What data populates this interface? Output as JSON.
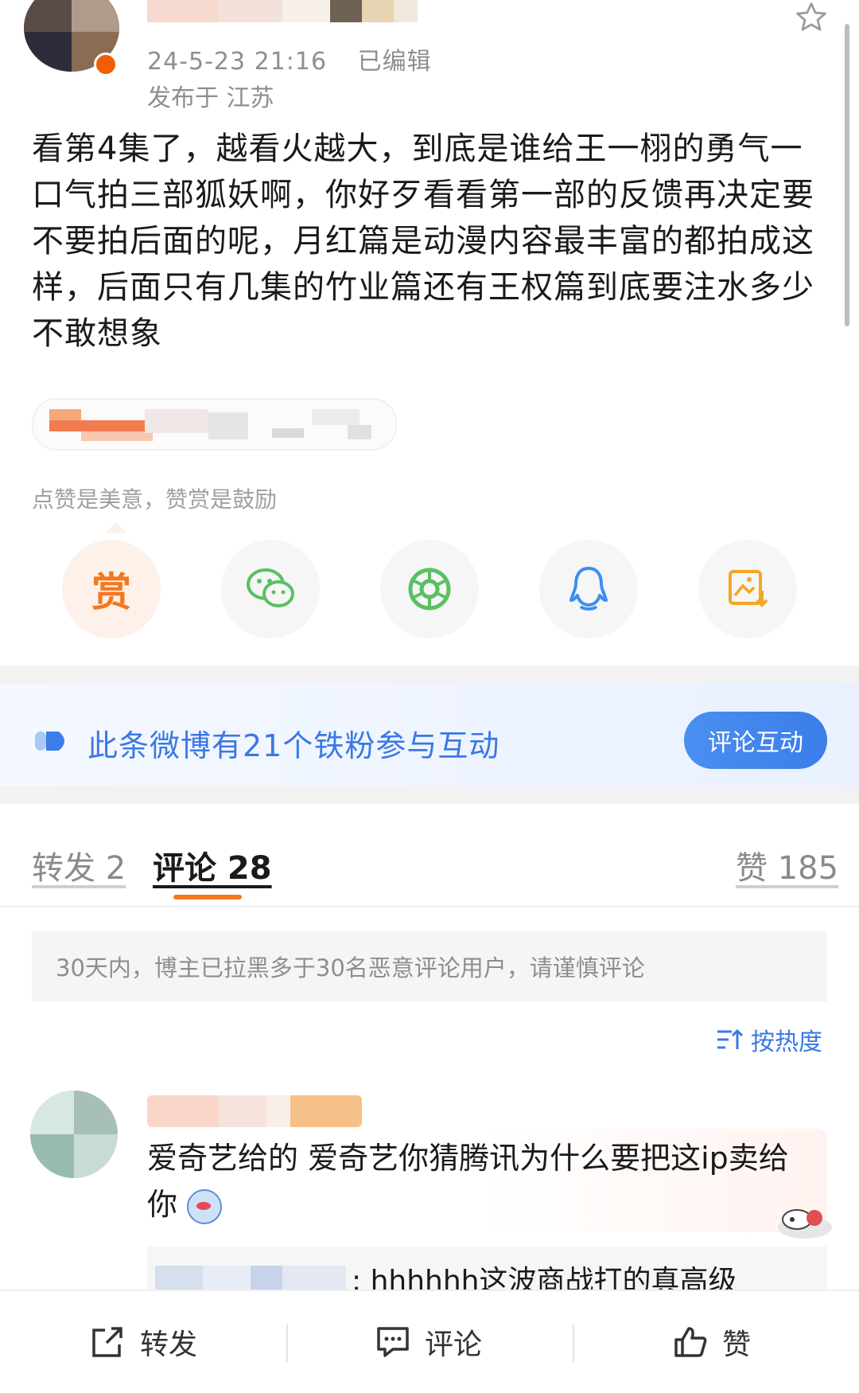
{
  "post": {
    "timestamp": "24-5-23 21:16",
    "edited_label": "已编辑",
    "location": "发布于 江苏",
    "text": "看第4集了，越看火越大，到底是谁给王一栩的勇气一口气拍三部狐妖啊，你好歹看看第一部的反馈再决定要不要拍后面的呢，月红篇是动漫内容最丰富的都拍成这样，后面只有几集的竹业篇还有王权篇到底要注水多少不敢想象",
    "reward_hint": "点赞是美意，赞赏是鼓励",
    "reward_label": "赏",
    "share_icons": [
      "reward-icon",
      "wechat-icon",
      "moments-icon",
      "qq-icon",
      "save-image-icon"
    ]
  },
  "fans_banner": {
    "text": "此条微博有21个铁粉参与互动",
    "button_label": "评论互动"
  },
  "tabs": {
    "repost": "转发 2",
    "comments": "评论 28",
    "likes": "赞 185"
  },
  "notice": "30天内，博主已拉黑多于30名恶意评论用户，请谨慎评论",
  "sort_label": "按热度",
  "comment": {
    "text": "爱奇艺给的 爱奇艺你猜腾讯为什么要把这ip卖给你",
    "reply_text": ": hhhhhh这波商战打的真高级"
  },
  "bottom_bar": {
    "repost": "转发",
    "comment": "评论",
    "like": "赞"
  },
  "colors": {
    "accent_orange": "#f5771f",
    "link_blue": "#3a78e6",
    "wechat_green": "#5bbf63",
    "qq_blue": "#3b8ef2"
  }
}
